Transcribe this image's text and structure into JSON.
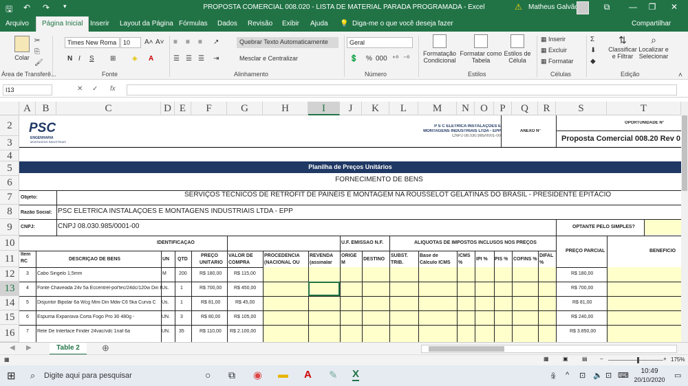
{
  "titlebar": {
    "title": "PROPOSTA COMERCIAL 008.020 - LISTA DE MATERIAL PARADA PROGRAMADA  -  Excel",
    "user": "Matheus Galvão",
    "warning_icon": "warning-icon",
    "win_buttons": [
      "⧉",
      "—",
      "❐",
      "✕"
    ]
  },
  "tabs": [
    "Arquivo",
    "Página Inicial",
    "Inserir",
    "Layout da Página",
    "Fórmulas",
    "Dados",
    "Revisão",
    "Exibir",
    "Ajuda"
  ],
  "tell_me": "Diga-me o que você deseja fazer",
  "share": "Compartilhar",
  "ribbon": {
    "clipboard": {
      "paste": "Colar",
      "group": "Área de Transferê..."
    },
    "font": {
      "name": "Times New Roma",
      "size": "10",
      "bold": "N",
      "italic": "I",
      "underline": "S",
      "group": "Fonte",
      "grow": "A˄",
      "shrink": "A˅"
    },
    "alignment": {
      "wrap": "Quebrar Texto Automaticamente",
      "merge": "Mesclar e Centralizar",
      "group": "Alinhamento"
    },
    "number": {
      "format": "Geral",
      "pct": "%",
      "thousands": "000",
      "group": "Número"
    },
    "styles": {
      "conditional": [
        "Formatação",
        "Condicional"
      ],
      "table": [
        "Formatar como",
        "Tabela"
      ],
      "cell": [
        "Estilos de",
        "Célula"
      ],
      "group": "Estilos"
    },
    "cells": {
      "insert": "Inserir",
      "delete": "Excluir",
      "format": "Formatar",
      "group": "Células"
    },
    "editing": {
      "sort": [
        "Classificar",
        "e Filtrar"
      ],
      "find": [
        "Localizar e",
        "Selecionar"
      ],
      "group": "Edição"
    }
  },
  "formula_bar": {
    "namebox": "I13",
    "fx": "fx",
    "formula": ""
  },
  "columns": [
    "A",
    "B",
    "C",
    "D",
    "E",
    "F",
    "G",
    "H",
    "I",
    "J",
    "K",
    "L",
    "M",
    "N",
    "O",
    "P",
    "Q",
    "R",
    "S",
    "T"
  ],
  "rows": [
    "2",
    "3",
    "4",
    "5",
    "6",
    "7",
    "8",
    "9",
    "10",
    "11",
    "12",
    "13",
    "14",
    "15",
    "16"
  ],
  "sheet": {
    "logo_text": "PSC",
    "logo_sub": "ENGENHARIA",
    "logo_sub2": "MONTAGENS INDUSTRIAIS",
    "company_head": [
      "P S C ELÉTRICA INSTALAÇÕES E",
      "MONTAGENS INDUSTRIAIS LTDA - EPP",
      "CNPJ 08.030.985/0001-00"
    ],
    "anexo": "ANEXO Nº",
    "oportunidade": "OPORTUNIDADE Nº",
    "proposta": "Proposta Comercial 008.20 Rev 0",
    "planilha": "Planilha de Preços Unitários",
    "fornecimento": "FORNECIMENTO DE BENS",
    "objeto_label": "Objeto:",
    "objeto": "SERVIÇOS TÉCNICOS DE RETROFIT DE PAINÉIS E MONTAGEM NA ROUSSELOT GELATINAS DO BRASIL - PRESIDENTE EPITÁCIO",
    "razao_label": "Razão Social:",
    "razao": "PSC ELÉTRICA INSTALAÇÕES E MONTAGENS INDUSTRIAIS LTDA - EPP",
    "cnpj_label": "CNPJ:",
    "cnpj": "CNPJ 08.030.985/0001-00",
    "optante": "OPTANTE PELO SIMPLES?",
    "identificacao": "IDENTIFICAÇÃO",
    "uf": "U.F. EMISSÃO N.F.",
    "aliquotas": "ALÍQUOTAS DE IMPOSTOS INCLUSOS NOS PREÇOS",
    "preco_parcial": "PREÇO PARCIAL",
    "beneficio": "BENEFÍCIO",
    "h_item": [
      "Item",
      "RC"
    ],
    "h_desc": "DESCRIÇÃO DE BENS",
    "h_un": "UN",
    "h_qtd": "QTD",
    "h_preco": [
      "PREÇO",
      "UNITÁRIO"
    ],
    "h_valor": [
      "VALOR DE",
      "COMPRA"
    ],
    "h_proc": [
      "PROCEDÊNCIA",
      "(NACIONAL OU"
    ],
    "h_rev": [
      "REVENDA",
      "(assinalar"
    ],
    "h_orig": [
      "ORIGE",
      "M"
    ],
    "h_dest": "DESTINO",
    "h_subst": [
      "SUBST.",
      "TRIB."
    ],
    "h_base": [
      "Base de",
      "Cálculo ICMS"
    ],
    "h_icms": [
      "ICMS",
      "%"
    ],
    "h_ipi": "IPI %",
    "h_pis": "PIS %",
    "h_cofins": "COFINS %",
    "h_difal": [
      "DIFAL",
      "%"
    ],
    "items": [
      {
        "rc": "3",
        "desc": "Cabo Singelo 1,5mm",
        "un": "M",
        "qtd": "200",
        "preco": "R$ 180,00",
        "valor": "R$ 115,00",
        "parcial": "R$ 180,00"
      },
      {
        "rc": "4",
        "desc": "Fonte Chaveada 24v 5a Eccentrel-pol'tec/24dc/120w Din Phoenic",
        "un": "Us.",
        "qtd": "1",
        "preco": "R$ 700,00",
        "valor": "R$ 450,00",
        "parcial": "R$ 700,00"
      },
      {
        "rc": "5",
        "desc": "Disjuntor Bipolar 6a Wcg Mini Din Mdw C6 5ka Curva C",
        "un": "Us.",
        "qtd": "1",
        "preco": "R$ 81,00",
        "valor": "R$ 45,00",
        "parcial": "R$ 81,00"
      },
      {
        "rc": "6",
        "desc": "Espuma Expansiva Corta Fogo Pro 30 480g -",
        "un": "UN.",
        "qtd": "3",
        "preco": "R$ 80,00",
        "valor": "R$ 105,00",
        "parcial": "R$ 240,00"
      },
      {
        "rc": "7",
        "desc": "Rele De Interface Finder 24vac/vdc 1naf 6a",
        "un": "UN.",
        "qtd": "35",
        "preco": "R$ 110,00",
        "valor": "R$ 2.100,00",
        "parcial": "R$ 3.850,00"
      }
    ]
  },
  "sheet_tab": "Table 2",
  "status": {
    "zoom": "175%"
  },
  "taskbar": {
    "search": "Digite aqui para pesquisar",
    "time": "10:49",
    "date": "20/10/2020"
  },
  "colors": {
    "excel_green": "#217346",
    "banner_navy": "#1f3864",
    "yellow_fill": "#ffffcc"
  }
}
